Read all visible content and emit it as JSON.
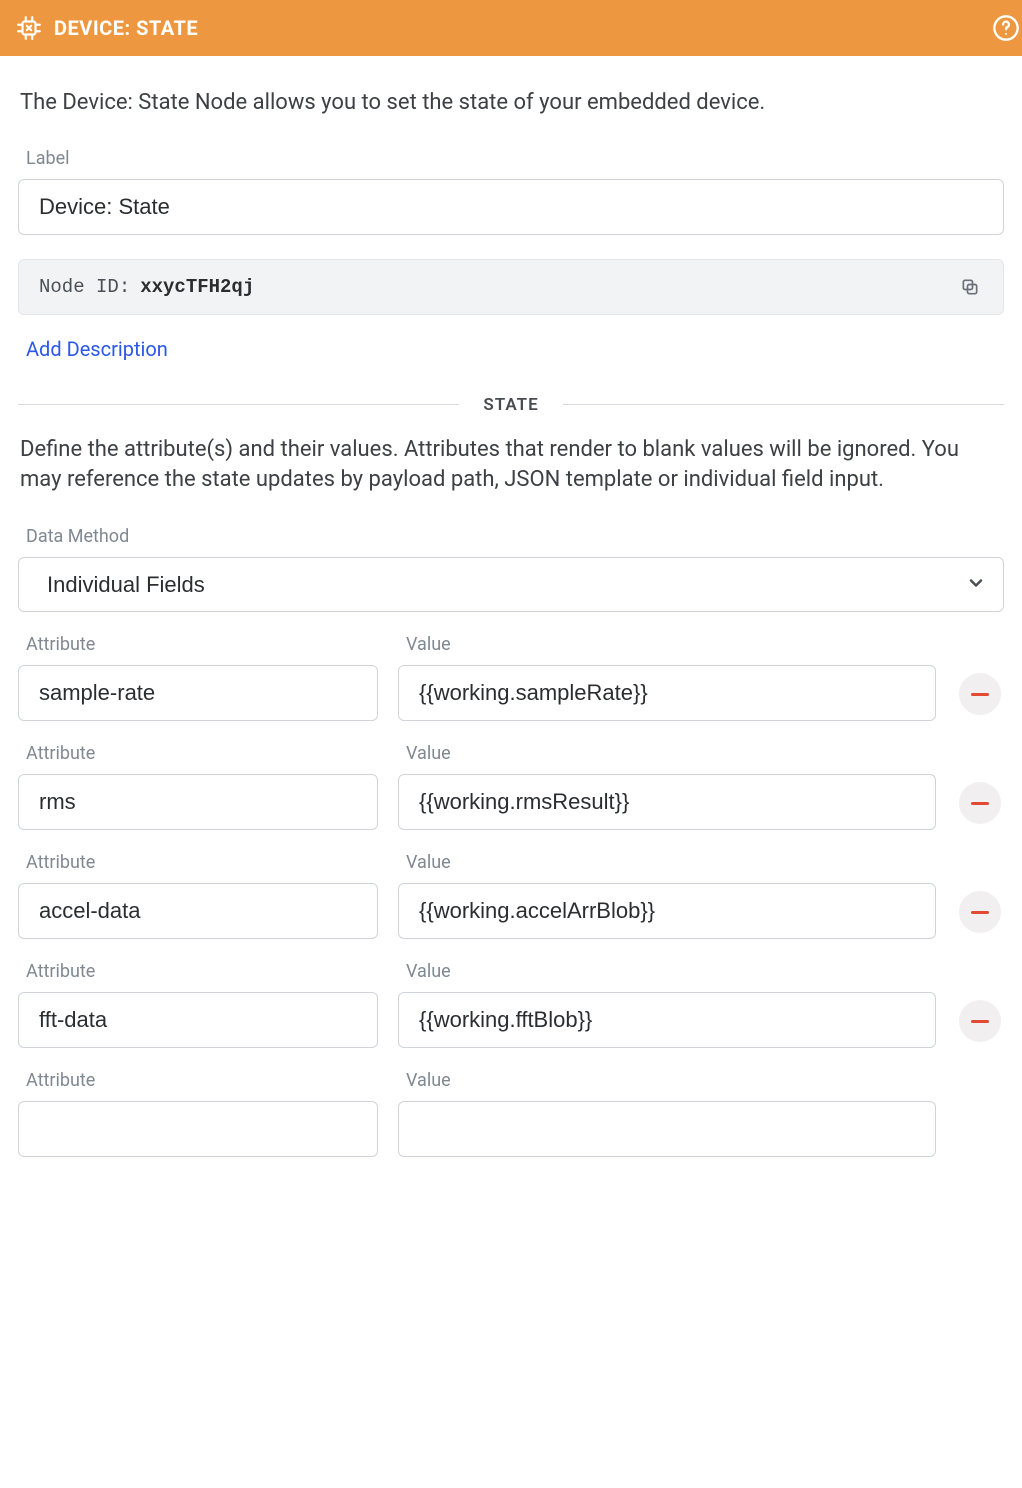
{
  "header": {
    "title": "DEVICE: STATE"
  },
  "intro": "The Device: State Node allows you to set the state of your embedded device.",
  "label": {
    "caption": "Label",
    "value": "Device: State"
  },
  "nodeId": {
    "caption": "Node ID:",
    "value": "xxycTFH2qj"
  },
  "addDescription": "Add Description",
  "sections": {
    "state": {
      "title": "STATE",
      "description": "Define the attribute(s) and their values. Attributes that render to blank values will be ignored. You may reference the state updates by payload path, JSON template or individual field input.",
      "dataMethod": {
        "caption": "Data Method",
        "value": "Individual Fields"
      },
      "columns": {
        "attribute": "Attribute",
        "value": "Value"
      },
      "rows": [
        {
          "attribute": "sample-rate",
          "value": "{{working.sampleRate}}",
          "deletable": true
        },
        {
          "attribute": "rms",
          "value": "{{working.rmsResult}}",
          "deletable": true
        },
        {
          "attribute": "accel-data",
          "value": "{{working.accelArrBlob}}",
          "deletable": true
        },
        {
          "attribute": "fft-data",
          "value": "{{working.fftBlob}}",
          "deletable": true
        },
        {
          "attribute": "",
          "value": "",
          "deletable": false
        }
      ]
    }
  }
}
